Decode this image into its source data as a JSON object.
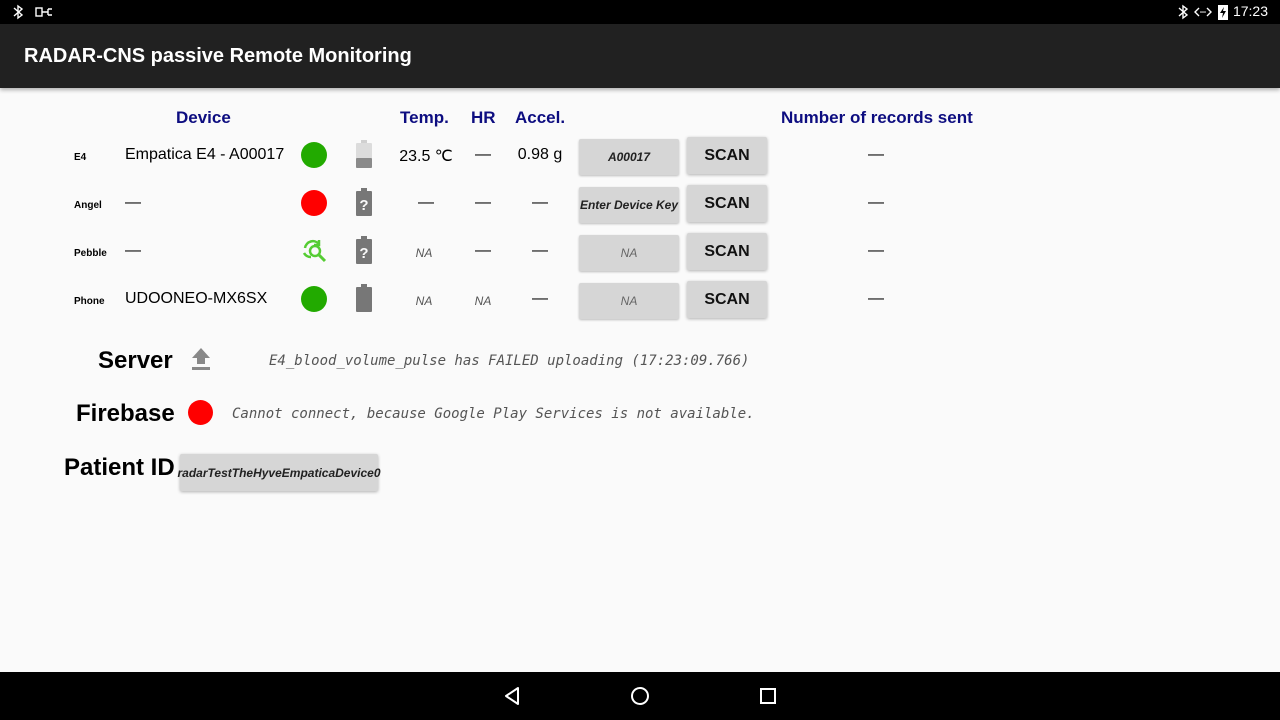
{
  "statusbar": {
    "time": "17:23"
  },
  "app": {
    "title": "RADAR-CNS passive Remote Monitoring"
  },
  "headers": {
    "device": "Device",
    "temp": "Temp.",
    "hr": "HR",
    "accel": "Accel.",
    "records": "Number of records sent"
  },
  "rows": [
    {
      "label": "E4",
      "name": "Empatica E4 - A00017",
      "status_color": "#22aa00",
      "temp": "23.5 ℃",
      "hr": "—",
      "accel": "0.98 g",
      "key": "A00017",
      "scan": "SCAN",
      "records": "—"
    },
    {
      "label": "Angel",
      "name": "—",
      "status_color": "#ff0000",
      "temp": "—",
      "hr": "—",
      "accel": "—",
      "key": "Enter Device Key",
      "scan": "SCAN",
      "records": "—"
    },
    {
      "label": "Pebble",
      "name": "—",
      "status_color": "#55cc33",
      "temp": "NA",
      "hr": "—",
      "accel": "—",
      "key": "NA",
      "scan": "SCAN",
      "records": "—"
    },
    {
      "label": "Phone",
      "name": "UDOONEO-MX6SX",
      "status_color": "#22aa00",
      "temp": "NA",
      "hr": "NA",
      "accel": "—",
      "key": "NA",
      "scan": "SCAN",
      "records": "—"
    }
  ],
  "server": {
    "label": "Server",
    "message": "E4_blood_volume_pulse has FAILED uploading (17:23:09.766)"
  },
  "firebase": {
    "label": "Firebase",
    "status_color": "#ff0000",
    "message": "Cannot connect, because Google Play Services is not available."
  },
  "patient": {
    "label": "Patient ID",
    "value": "radarTestTheHyveEmpaticaDevice0"
  }
}
